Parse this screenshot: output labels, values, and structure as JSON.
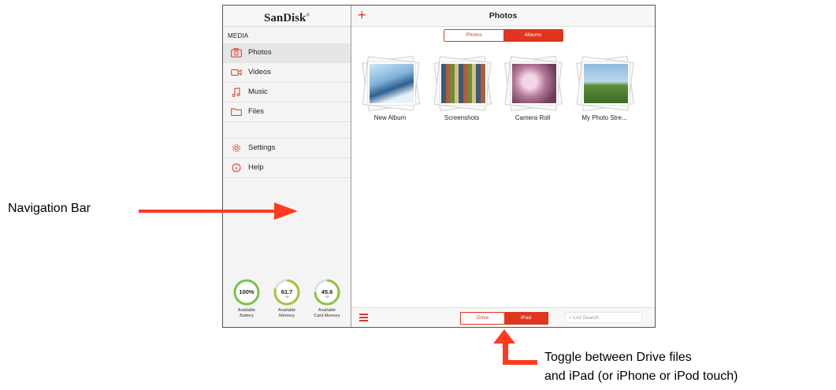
{
  "sidebar": {
    "brand": "SanDisk",
    "brand_mark": "®",
    "section": "MEDIA",
    "items": [
      {
        "label": "Photos",
        "icon": "camera-icon"
      },
      {
        "label": "Videos",
        "icon": "video-camera-icon"
      },
      {
        "label": "Music",
        "icon": "music-note-icon"
      },
      {
        "label": "Files",
        "icon": "folder-icon"
      }
    ],
    "items2": [
      {
        "label": "Settings",
        "icon": "gear-icon"
      },
      {
        "label": "Help",
        "icon": "info-icon"
      }
    ],
    "gauges": [
      {
        "value": "100%",
        "unit": "",
        "label1": "Available",
        "label2": "Battery",
        "fraction": 1.0
      },
      {
        "value": "61.7",
        "unit": "GB",
        "label1": "Available",
        "label2": "Memory",
        "fraction": 0.8
      },
      {
        "value": "45.6",
        "unit": "GB",
        "label1": "Available",
        "label2": "Card Memory",
        "fraction": 0.75
      }
    ]
  },
  "main": {
    "title": "Photos",
    "add_icon": "+",
    "segment": {
      "photos": "Photos",
      "albums": "Albums",
      "selected": "Albums"
    },
    "albums": [
      {
        "label": "New Album"
      },
      {
        "label": "Screenshots"
      },
      {
        "label": "Camera Roll"
      },
      {
        "label": "My Photo Stre..."
      }
    ],
    "toggle": {
      "drive": "Drive",
      "device": "iPad",
      "selected": "iPad"
    },
    "search_placeholder": "List Search"
  },
  "annotations": {
    "nav_bar": "Navigation Bar",
    "toggle_line1": "Toggle between Drive files",
    "toggle_line2": "and iPad (or iPhone or iPod touch)"
  },
  "colors": {
    "accent": "#e0351f",
    "arrow": "#ff3b1f"
  }
}
